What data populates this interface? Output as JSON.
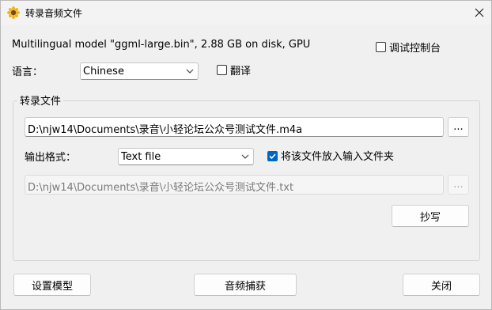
{
  "window": {
    "title": "转录音频文件",
    "icon": "sunflower-icon"
  },
  "model_info": "Multilingual model \"ggml-large.bin\", 2.88 GB on disk, GPU",
  "debug_console": {
    "label": "调试控制台",
    "checked": false
  },
  "language": {
    "label": "语言：",
    "value": "Chinese"
  },
  "translate": {
    "label": "翻译",
    "checked": false
  },
  "transcribe_group": {
    "title": "转录文件",
    "input_path": "D:\\njw14\\Documents\\录音\\小轻论坛公众号测试文件.m4a",
    "browse_label": "...",
    "output_format_label": "输出格式：",
    "output_format_value": "Text file",
    "place_in_input_folder": {
      "label": "将该文件放入输入文件夹",
      "checked": true
    },
    "output_path": "D:\\njw14\\Documents\\录音\\小轻论坛公众号测试文件.txt",
    "output_browse_label": "...",
    "transcribe_button": "抄写"
  },
  "footer": {
    "setup_model": "设置模型",
    "audio_capture": "音频捕获",
    "close": "关闭"
  },
  "colors": {
    "accent": "#0067c0",
    "background": "#f0f0f0"
  }
}
